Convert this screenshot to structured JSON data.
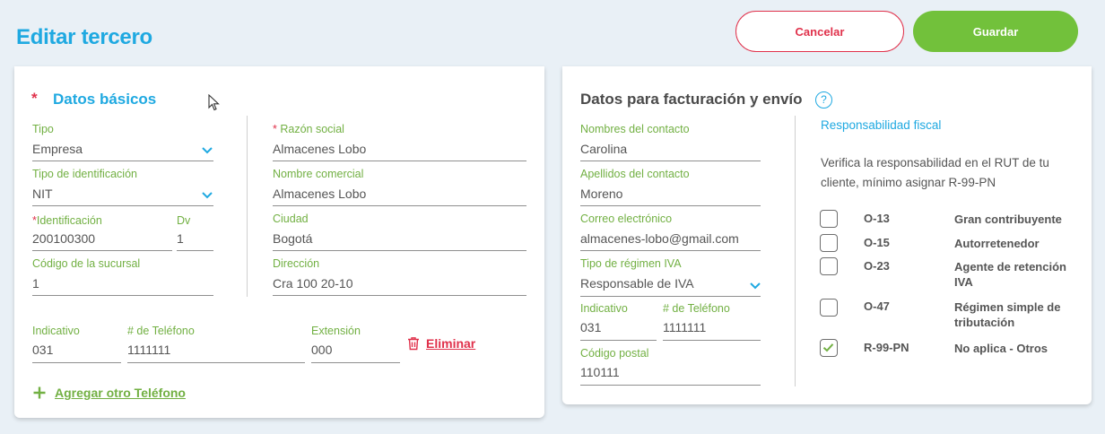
{
  "header": {
    "title": "Editar tercero",
    "cancel_label": "Cancelar",
    "save_label": "Guardar"
  },
  "basic": {
    "required_mark": "*",
    "title": "Datos básicos",
    "tipo": {
      "label": "Tipo",
      "value": "Empresa"
    },
    "tipo_identificacion": {
      "label": "Tipo de identificación",
      "value": "NIT"
    },
    "identificacion": {
      "star": "*",
      "label": "Identificación",
      "value": "200100300"
    },
    "dv": {
      "label": "Dv",
      "value": "1"
    },
    "codigo_sucursal": {
      "label": "Código de la sucursal",
      "value": "1"
    },
    "razon_social": {
      "star": "*",
      "label": "Razón social",
      "value": "Almacenes Lobo"
    },
    "nombre_comercial": {
      "label": "Nombre comercial",
      "value": "Almacenes Lobo"
    },
    "ciudad": {
      "label": "Ciudad",
      "value": "Bogotá"
    },
    "direccion": {
      "label": "Dirección",
      "value": "Cra 100 20-10"
    },
    "phone": {
      "indicativo_label": "Indicativo",
      "indicativo_value": "031",
      "telefono_label": "# de Teléfono",
      "telefono_value": "1111111",
      "extension_label": "Extensión",
      "extension_value": "000",
      "delete_label": "Eliminar"
    },
    "add_phone_label": "Agregar otro Teléfono"
  },
  "billing": {
    "title": "Datos para facturación y envío",
    "help_glyph": "?",
    "nombres": {
      "label": "Nombres del contacto",
      "value": "Carolina"
    },
    "apellidos": {
      "label": "Apellidos del contacto",
      "value": "Moreno"
    },
    "correo": {
      "label": "Correo electrónico",
      "value": "almacenes-lobo@gmail.com"
    },
    "regimen": {
      "label": "Tipo de régimen IVA",
      "value": "Responsable de IVA"
    },
    "indicativo": {
      "label": "Indicativo",
      "value": "031"
    },
    "telefono": {
      "label": "# de Teléfono",
      "value": "1111111"
    },
    "codigo_postal": {
      "label": "Código postal",
      "value": "110111"
    }
  },
  "fiscal": {
    "link_label": "Responsabilidad fiscal",
    "description": "Verifica la responsabilidad en el RUT de tu cliente, mínimo asignar R-99-PN",
    "items": [
      {
        "code": "O-13",
        "label": "Gran contribuyente",
        "checked": false
      },
      {
        "code": "O-15",
        "label": "Autorretenedor",
        "checked": false
      },
      {
        "code": "O-23",
        "label": "Agente de retención IVA",
        "checked": false
      },
      {
        "code": "O-47",
        "label": "Régimen simple de tributación",
        "checked": false
      },
      {
        "code": "R-99-PN",
        "label": "No aplica - Otros",
        "checked": true
      }
    ]
  },
  "colors": {
    "accent_blue": "#1fa9e1",
    "accent_green": "#72c13b",
    "accent_red": "#e0314b",
    "background": "#e9f0f6"
  }
}
